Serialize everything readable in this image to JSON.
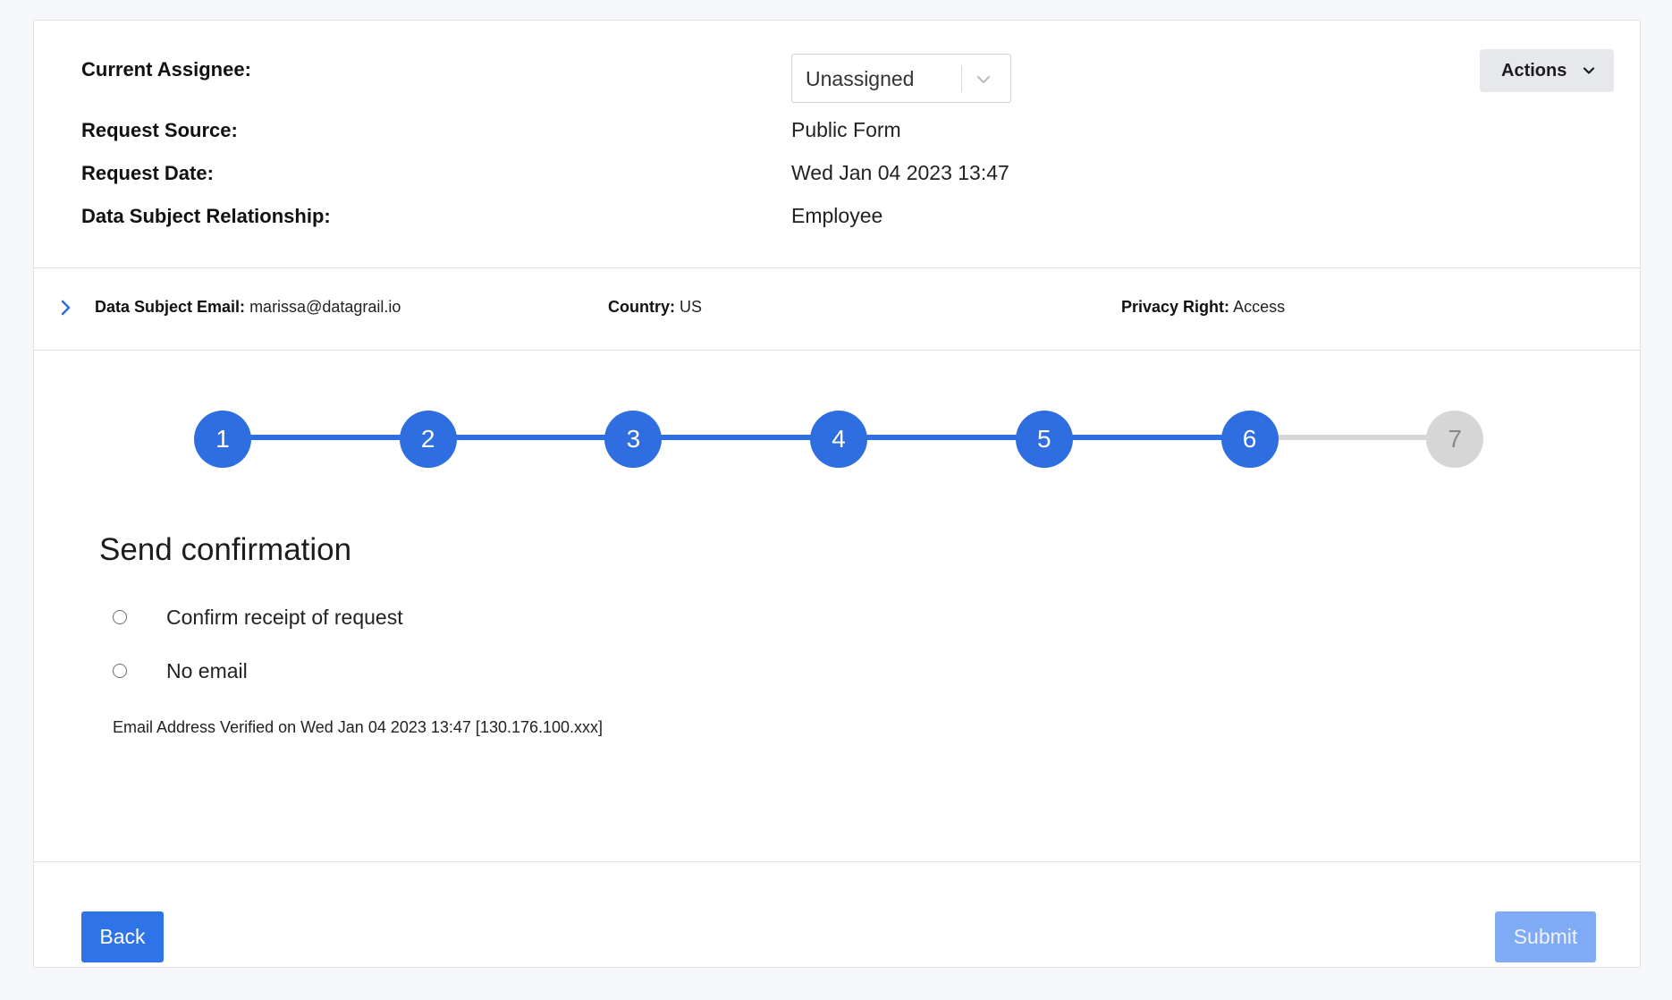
{
  "info": {
    "assignee_label": "Current Assignee:",
    "assignee_value": "Unassigned",
    "source_label": "Request Source:",
    "source_value": "Public Form",
    "date_label": "Request Date:",
    "date_value": "Wed Jan 04 2023 13:47",
    "relationship_label": "Data Subject Relationship:",
    "relationship_value": "Employee"
  },
  "actions": {
    "label": "Actions",
    "icon": "chevron-down-icon"
  },
  "subject": {
    "email_label": "Data Subject Email:",
    "email_value": "marissa@datagrail.io",
    "country_label": "Country:",
    "country_value": "US",
    "right_label": "Privacy Right:",
    "right_value": "Access"
  },
  "stepper": {
    "steps": [
      "1",
      "2",
      "3",
      "4",
      "5",
      "6",
      "7"
    ],
    "completed_count": 6,
    "active_color": "#2f6ee0",
    "inactive_color": "#d6d6d6",
    "inactive_text_color": "#8a8a8a"
  },
  "confirmation": {
    "title": "Send confirmation",
    "options": [
      "Confirm receipt of request",
      "No email"
    ],
    "verified_note": "Email Address Verified on Wed Jan 04 2023 13:47 [130.176.100.xxx]"
  },
  "footer": {
    "back_label": "Back",
    "submit_label": "Submit"
  },
  "colors": {
    "primary": "#2f73e8",
    "primary_disabled": "#7eaaf6",
    "chevron_blue": "#2f6ee0"
  }
}
